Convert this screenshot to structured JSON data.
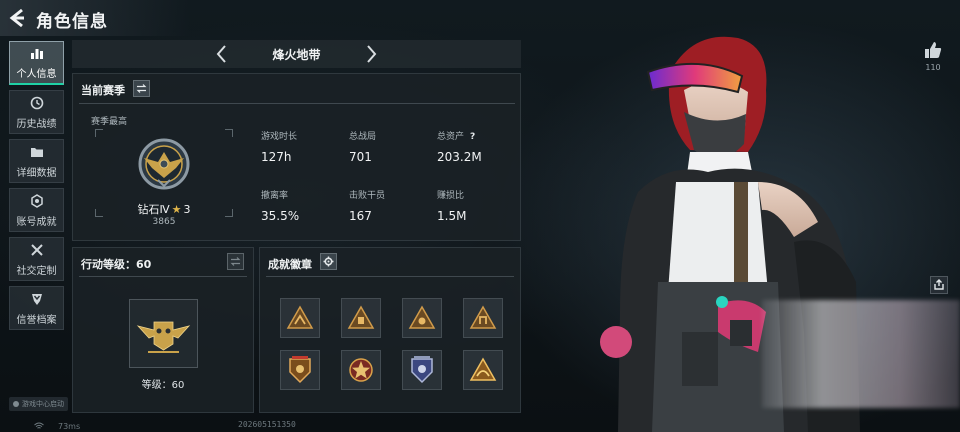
{
  "header": {
    "title": "角色信息"
  },
  "nav": {
    "items": [
      {
        "label": "个人信息",
        "icon": "bar-chart-icon",
        "active": true
      },
      {
        "label": "历史战绩",
        "icon": "history-clock-icon",
        "active": false
      },
      {
        "label": "详细数据",
        "icon": "folder-icon",
        "active": false
      },
      {
        "label": "账号成就",
        "icon": "achievement-badge-icon",
        "active": false
      },
      {
        "label": "社交定制",
        "icon": "tools-icon",
        "active": false
      },
      {
        "label": "信誉档案",
        "icon": "shield-chevron-icon",
        "active": false
      }
    ],
    "game_center": "游戏中心启动"
  },
  "mode_selector": {
    "current": "烽火地带"
  },
  "season_panel": {
    "title": "当前赛季",
    "best_label": "赛季最高",
    "rank": {
      "name": "钻石Ⅳ",
      "stars": "3",
      "score": "3865"
    },
    "stats": [
      {
        "key": "游戏时长",
        "value": "127h"
      },
      {
        "key": "总战局",
        "value": "701"
      },
      {
        "key": "总资产",
        "value": "203.2M",
        "has_help": true
      },
      {
        "key": "撤离率",
        "value": "35.5%"
      },
      {
        "key": "击败干员",
        "value": "167"
      },
      {
        "key": "赚损比",
        "value": "1.5M"
      }
    ]
  },
  "action_panel": {
    "title": "行动等级：60",
    "level_label": "等级：60"
  },
  "badges_panel": {
    "title": "成就徽章",
    "badges": [
      "triangle-bronze-badge-icon",
      "triangle-bronze-badge-icon",
      "triangle-bronze-badge-icon",
      "triangle-bronze-badge-icon",
      "shield-gold-badge-icon",
      "star-gold-badge-icon",
      "shield-silver-badge-icon",
      "triangle-gold-badge-icon"
    ]
  },
  "social": {
    "like_count": "110"
  },
  "status_bar": {
    "ping": "73ms",
    "uid": "202605151350"
  },
  "colors": {
    "accent": "#1fd2a6",
    "gold": "#c9a24a",
    "bg": "#0c1114"
  }
}
